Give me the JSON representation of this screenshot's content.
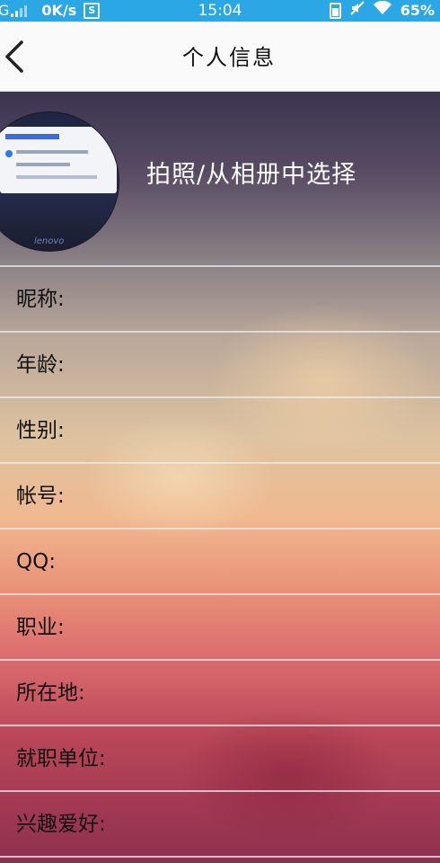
{
  "status_bar": {
    "network": "G",
    "speed": "0K/s",
    "s_badge": "S",
    "time": "15:04",
    "battery": "65%",
    "colors": {
      "background": "#2aa7e4"
    }
  },
  "header": {
    "title": "个人信息",
    "back_icon": "chevron-left-icon"
  },
  "profile": {
    "photo_action": "拍照/从相册中选择",
    "avatar_brand": "lenovo"
  },
  "fields": [
    {
      "label": "昵称:",
      "value": ""
    },
    {
      "label": "年龄:",
      "value": ""
    },
    {
      "label": "性别:",
      "value": ""
    },
    {
      "label": "帐号:",
      "value": ""
    },
    {
      "label": "QQ:",
      "value": ""
    },
    {
      "label": "职业:",
      "value": ""
    },
    {
      "label": "所在地:",
      "value": ""
    },
    {
      "label": "就职单位:",
      "value": ""
    },
    {
      "label": "兴趣爱好:",
      "value": ""
    }
  ]
}
